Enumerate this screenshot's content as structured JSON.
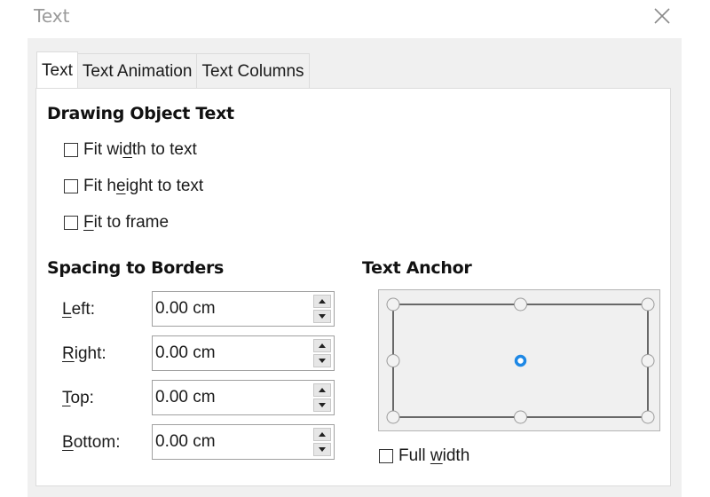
{
  "window": {
    "title": "Text",
    "close_icon": "close-icon"
  },
  "tabs": [
    {
      "label": "Text",
      "active": true
    },
    {
      "label": "Text Animation",
      "active": false
    },
    {
      "label": "Text Columns",
      "active": false
    }
  ],
  "drawing_object_text": {
    "heading": "Drawing Object Text",
    "options": [
      {
        "pre": "Fit wi",
        "mnemonic": "d",
        "post": "th to text",
        "checked": false
      },
      {
        "pre": "Fit h",
        "mnemonic": "e",
        "post": "ight to text",
        "checked": false
      },
      {
        "pre": "",
        "mnemonic": "F",
        "post": "it to frame",
        "checked": false
      }
    ]
  },
  "spacing_to_borders": {
    "heading": "Spacing to Borders",
    "fields": [
      {
        "mnemonic": "L",
        "rest": "eft:",
        "value": "0.00 cm"
      },
      {
        "mnemonic": "R",
        "rest": "ight:",
        "value": "0.00 cm"
      },
      {
        "mnemonic": "T",
        "rest": "op:",
        "value": "0.00 cm"
      },
      {
        "mnemonic": "B",
        "rest": "ottom:",
        "value": "0.00 cm"
      }
    ]
  },
  "text_anchor": {
    "heading": "Text Anchor",
    "selected": "center",
    "points": [
      "top-left",
      "top-center",
      "top-right",
      "middle-left",
      "center",
      "middle-right",
      "bottom-left",
      "bottom-center",
      "bottom-right"
    ],
    "selected_color": "#1e88e5",
    "full_width": {
      "pre": "Full ",
      "mnemonic": "w",
      "post": "idth",
      "checked": false
    }
  }
}
